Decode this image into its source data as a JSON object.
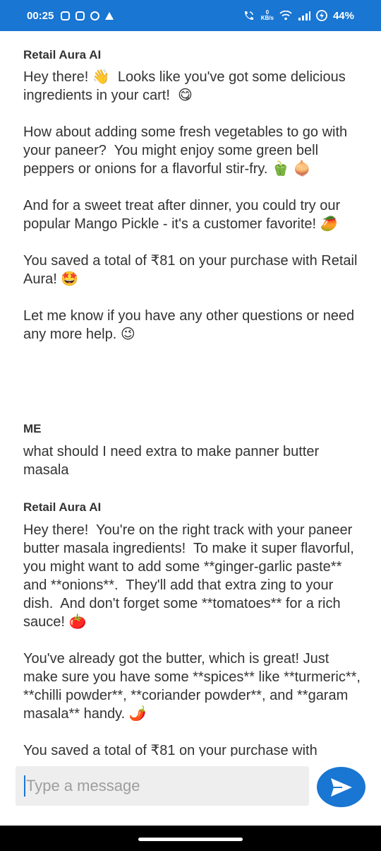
{
  "status_bar": {
    "time": "00:25",
    "net_speed_value": "0",
    "net_speed_unit": "KB/s",
    "battery": "44%",
    "icons": [
      "instagram-icon",
      "instagram-icon",
      "notification-icon",
      "drive-icon",
      "call-wifi-icon",
      "wifi-icon",
      "signal-icon",
      "battery-icon"
    ]
  },
  "messages": [
    {
      "sender": "Retail Aura AI",
      "text": "Hey there! 👋  Looks like you've got some delicious ingredients in your cart!  😋\n\nHow about adding some fresh vegetables to go with your paneer?  You might enjoy some green bell peppers or onions for a flavorful stir-fry. 🫑 🧅\n\nAnd for a sweet treat after dinner, you could try our popular Mango Pickle - it's a customer favorite! 🥭\n\nYou saved a total of ₹81 on your purchase with Retail Aura! 🤩\n\nLet me know if you have any other questions or need any more help. 😉"
    },
    {
      "sender": "ME",
      "text": "what should I need extra to make panner butter masala"
    },
    {
      "sender": "Retail Aura AI",
      "text": "Hey there!  You're on the right track with your paneer butter masala ingredients!  To make it super flavorful, you might want to add some **ginger-garlic paste** and **onions**.  They'll add that extra zing to your dish.  And don't forget some **tomatoes** for a rich sauce! 🍅\n\nYou've already got the butter, which is great! Just make sure you have some **spices** like **turmeric**, **chilli powder**, **coriander powder**, and **garam masala** handy. 🌶️\n\nYou saved a total of ₹81 on your purchase with"
    }
  ],
  "composer": {
    "placeholder": "Type a message",
    "value": ""
  },
  "colors": {
    "accent": "#1976d2",
    "input_bg": "#eeeeee"
  }
}
